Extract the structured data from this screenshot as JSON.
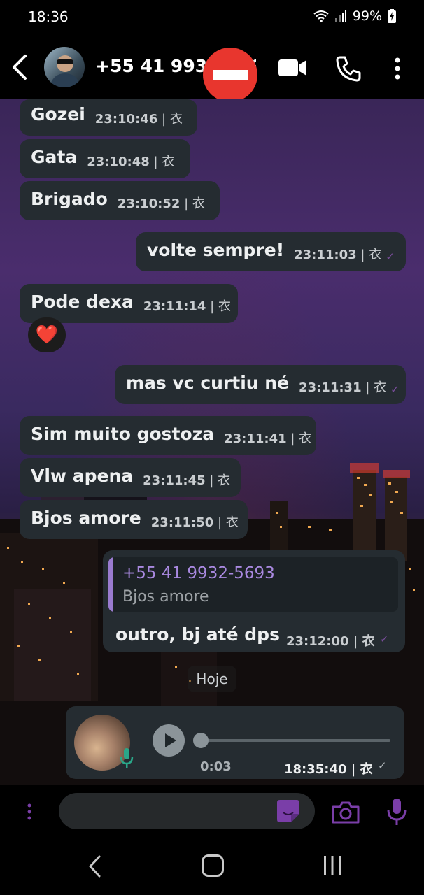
{
  "status_bar": {
    "time": "18:36",
    "battery": "99%"
  },
  "header": {
    "contact": "+55 41 9932-5693"
  },
  "messages": [
    {
      "text": "Gozei",
      "time": "23:10:46",
      "sep": " | 衣",
      "dir": "in"
    },
    {
      "text": "Gata",
      "time": "23:10:48",
      "sep": " | 衣",
      "dir": "in"
    },
    {
      "text": "Brigado",
      "time": "23:10:52",
      "sep": " | 衣",
      "dir": "in"
    },
    {
      "text": "volte sempre!",
      "time": "23:11:03",
      "sep": " | 衣",
      "dir": "out"
    },
    {
      "text": "Pode dexa",
      "time": "23:11:14",
      "sep": " | 衣",
      "dir": "in",
      "reaction": "❤️"
    },
    {
      "text": "mas vc curtiu né",
      "time": "23:11:31",
      "sep": " | 衣",
      "dir": "out"
    },
    {
      "text": "Sim muito gostoza",
      "time": "23:11:41",
      "sep": " | 衣",
      "dir": "in"
    },
    {
      "text": "Vlw apena",
      "time": "23:11:45",
      "sep": " | 衣",
      "dir": "in"
    },
    {
      "text": "Bjos amore",
      "time": "23:11:50",
      "sep": " | 衣",
      "dir": "in"
    }
  ],
  "reply_message": {
    "quoted_author": "+55 41 9932-5693",
    "quoted_text": "Bjos amore",
    "text": "outro, bj até dps",
    "time": "23:12:00 | 衣"
  },
  "date_divider": "Hoje",
  "voice_message": {
    "duration": "0:03",
    "time": "18:35:40 | 衣"
  },
  "colors": {
    "bubble": "#252c31",
    "accent": "#7a3ea8",
    "quote_accent": "#9a7bd0",
    "block_badge": "#e8362e"
  }
}
